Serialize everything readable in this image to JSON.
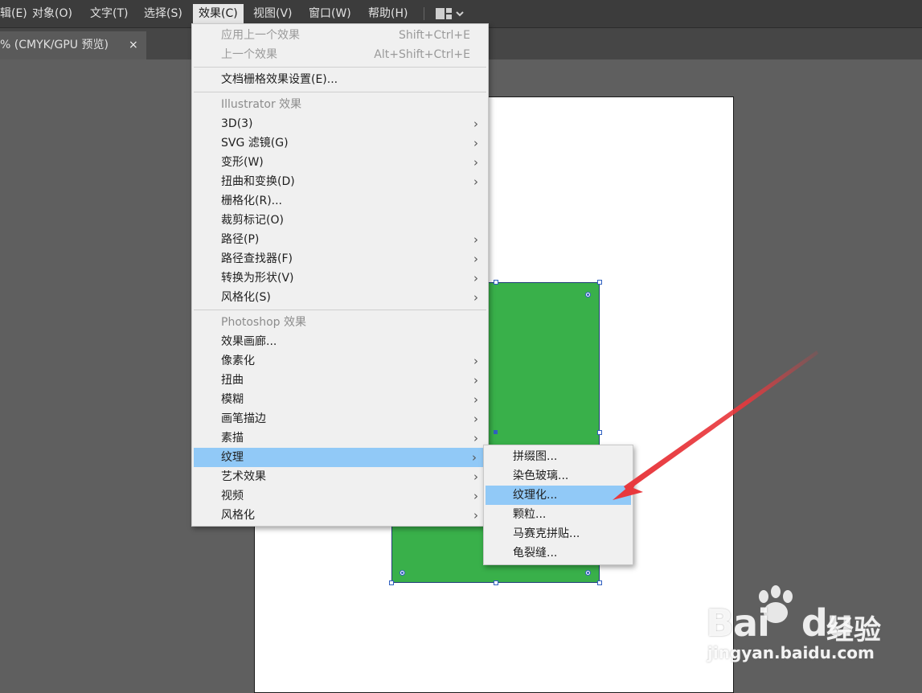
{
  "menubar": {
    "items": [
      {
        "label": "辑(E)"
      },
      {
        "label": "对象(O)"
      },
      {
        "label": "文字(T)"
      },
      {
        "label": "选择(S)"
      },
      {
        "label": "效果(C)",
        "active": true
      },
      {
        "label": "视图(V)"
      },
      {
        "label": "窗口(W)"
      },
      {
        "label": "帮助(H)"
      }
    ],
    "workspace_icon": "workspace-layout-icon",
    "workspace_chevron": "⌄"
  },
  "tab": {
    "label": "% (CMYK/GPU 预览)",
    "close": "×"
  },
  "effect_menu": {
    "apply_last": {
      "label": "应用上一个效果",
      "shortcut": "Shift+Ctrl+E"
    },
    "last": {
      "label": "上一个效果",
      "shortcut": "Alt+Shift+Ctrl+E"
    },
    "raster_settings": {
      "label": "文档栅格效果设置(E)..."
    },
    "illustrator_header": "Illustrator 效果",
    "illustrator_items": [
      {
        "label": "3D(3)",
        "submenu": true
      },
      {
        "label": "SVG 滤镜(G)",
        "submenu": true
      },
      {
        "label": "变形(W)",
        "submenu": true
      },
      {
        "label": "扭曲和变换(D)",
        "submenu": true
      },
      {
        "label": "栅格化(R)...",
        "submenu": false
      },
      {
        "label": "裁剪标记(O)",
        "submenu": false
      },
      {
        "label": "路径(P)",
        "submenu": true
      },
      {
        "label": "路径查找器(F)",
        "submenu": true
      },
      {
        "label": "转换为形状(V)",
        "submenu": true
      },
      {
        "label": "风格化(S)",
        "submenu": true
      }
    ],
    "photoshop_header": "Photoshop 效果",
    "photoshop_items": [
      {
        "label": "效果画廊...",
        "submenu": false
      },
      {
        "label": "像素化",
        "submenu": true
      },
      {
        "label": "扭曲",
        "submenu": true
      },
      {
        "label": "模糊",
        "submenu": true
      },
      {
        "label": "画笔描边",
        "submenu": true
      },
      {
        "label": "素描",
        "submenu": true
      },
      {
        "label": "纹理",
        "submenu": true,
        "highlight": true
      },
      {
        "label": "艺术效果",
        "submenu": true
      },
      {
        "label": "视频",
        "submenu": true
      },
      {
        "label": "风格化",
        "submenu": true
      }
    ],
    "arrow_glyph": "›"
  },
  "texture_submenu": {
    "items": [
      {
        "label": "拼缀图..."
      },
      {
        "label": "染色玻璃..."
      },
      {
        "label": "纹理化...",
        "highlight": true
      },
      {
        "label": "颗粒..."
      },
      {
        "label": "马赛克拼贴..."
      },
      {
        "label": "龟裂缝..."
      }
    ]
  },
  "colors": {
    "menubar_bg": "#3c3c3c",
    "menu_bg": "#f0f0f0",
    "highlight": "#91c9f7",
    "shape_fill": "#39b04a",
    "arrow": "#e8383d"
  },
  "watermark": {
    "brand": "Bai",
    "brand_suffix": "du",
    "name": "经验",
    "url": "jingyan.baidu.com"
  }
}
